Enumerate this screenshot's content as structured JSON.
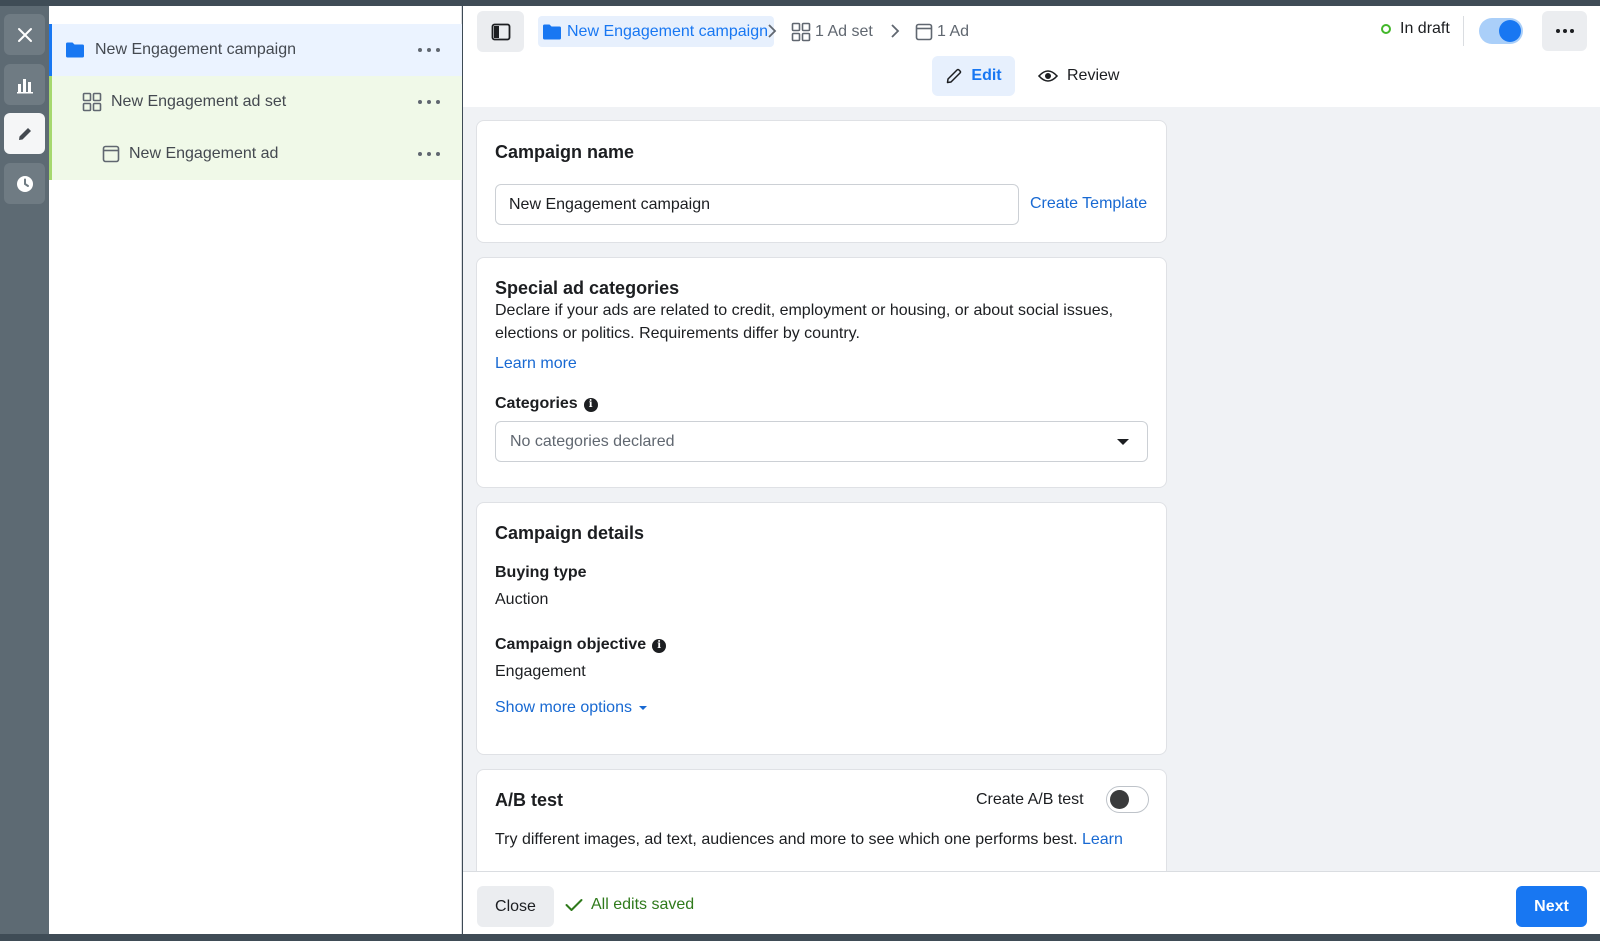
{
  "tree": {
    "items": [
      {
        "label": "New Engagement campaign",
        "icon": "folder-icon"
      },
      {
        "label": "New Engagement ad set",
        "icon": "grid-icon"
      },
      {
        "label": "New Engagement ad",
        "icon": "ad-page-icon"
      }
    ]
  },
  "breadcrumb": {
    "campaign": "New Engagement campaign",
    "adset": "1 Ad set",
    "ad": "1 Ad"
  },
  "status": {
    "label": "In draft",
    "toggle_on": true
  },
  "modes": {
    "edit": "Edit",
    "review": "Review"
  },
  "campaign_name_card": {
    "title": "Campaign name",
    "value": "New Engagement campaign",
    "create_template": "Create Template"
  },
  "special_categories_card": {
    "title": "Special ad categories",
    "description": "Declare if your ads are related to credit, employment or housing, or about social issues, elections or politics. Requirements differ by country.",
    "learn_more": "Learn more",
    "categories_label": "Categories",
    "categories_value": "No categories declared"
  },
  "campaign_details_card": {
    "title": "Campaign details",
    "buying_type_label": "Buying type",
    "buying_type_value": "Auction",
    "objective_label": "Campaign objective",
    "objective_value": "Engagement",
    "show_more": "Show more options"
  },
  "ab_test_card": {
    "title": "A/B test",
    "toggle_label": "Create A/B test",
    "toggle_on": false,
    "description": "Try different images, ad text, audiences and more to see which one performs best.",
    "learn": "Learn"
  },
  "footer": {
    "close": "Close",
    "saved": "All edits saved",
    "next": "Next"
  },
  "colors": {
    "accent": "#1877f2",
    "success": "#42b72a",
    "draft_green": "#a6d86e"
  }
}
